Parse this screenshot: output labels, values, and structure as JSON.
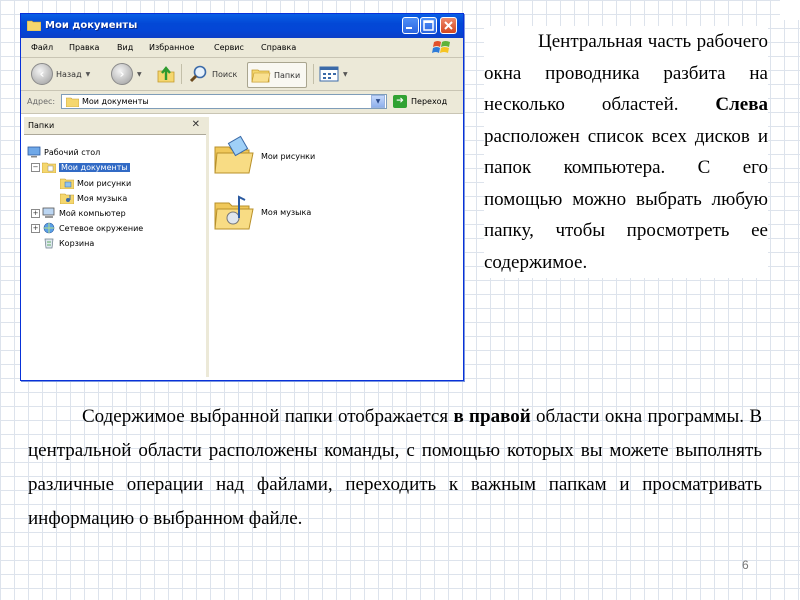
{
  "window": {
    "title": "Мои документы",
    "menu": [
      "Файл",
      "Правка",
      "Вид",
      "Избранное",
      "Сервис",
      "Справка"
    ],
    "toolbar": {
      "back_label": "Назад",
      "search_label": "Поиск",
      "folders_label": "Папки"
    },
    "address": {
      "label": "Адрес:",
      "value": "Мои документы",
      "go_label": "Переход"
    },
    "folders_pane": {
      "title": "Папки",
      "tree": [
        {
          "label": "Рабочий стол"
        },
        {
          "label": "Мои документы",
          "selected": true
        },
        {
          "label": "Мои рисунки"
        },
        {
          "label": "Моя музыка"
        },
        {
          "label": "Мой компьютер"
        },
        {
          "label": "Сетевое окружение"
        },
        {
          "label": "Корзина"
        }
      ]
    },
    "items": [
      {
        "label": "Мои рисунки"
      },
      {
        "label": "Моя музыка"
      }
    ]
  },
  "side_text": {
    "part1": "Центральная часть рабочего окна проводника разбита на несколько областей.",
    "bold": "Слева",
    "part2": "расположен список всех дисков и папок компьютера. С его помощью можно выбрать любую папку, чтобы просмотреть ее содержимое."
  },
  "bottom_text": {
    "part1": "Содержимое выбранной папки отображается",
    "bold": "в правой",
    "part2": "области окна программы. В центральной области расположены команды, с помощью которых вы можете выполнять различные операции над файлами, переходить к важным папкам и просматривать информацию о выбранном файле."
  },
  "page_number": "6",
  "colors": {
    "titlebar": "#0348d6",
    "selection": "#316ac5",
    "window_bg": "#ece9d8"
  }
}
